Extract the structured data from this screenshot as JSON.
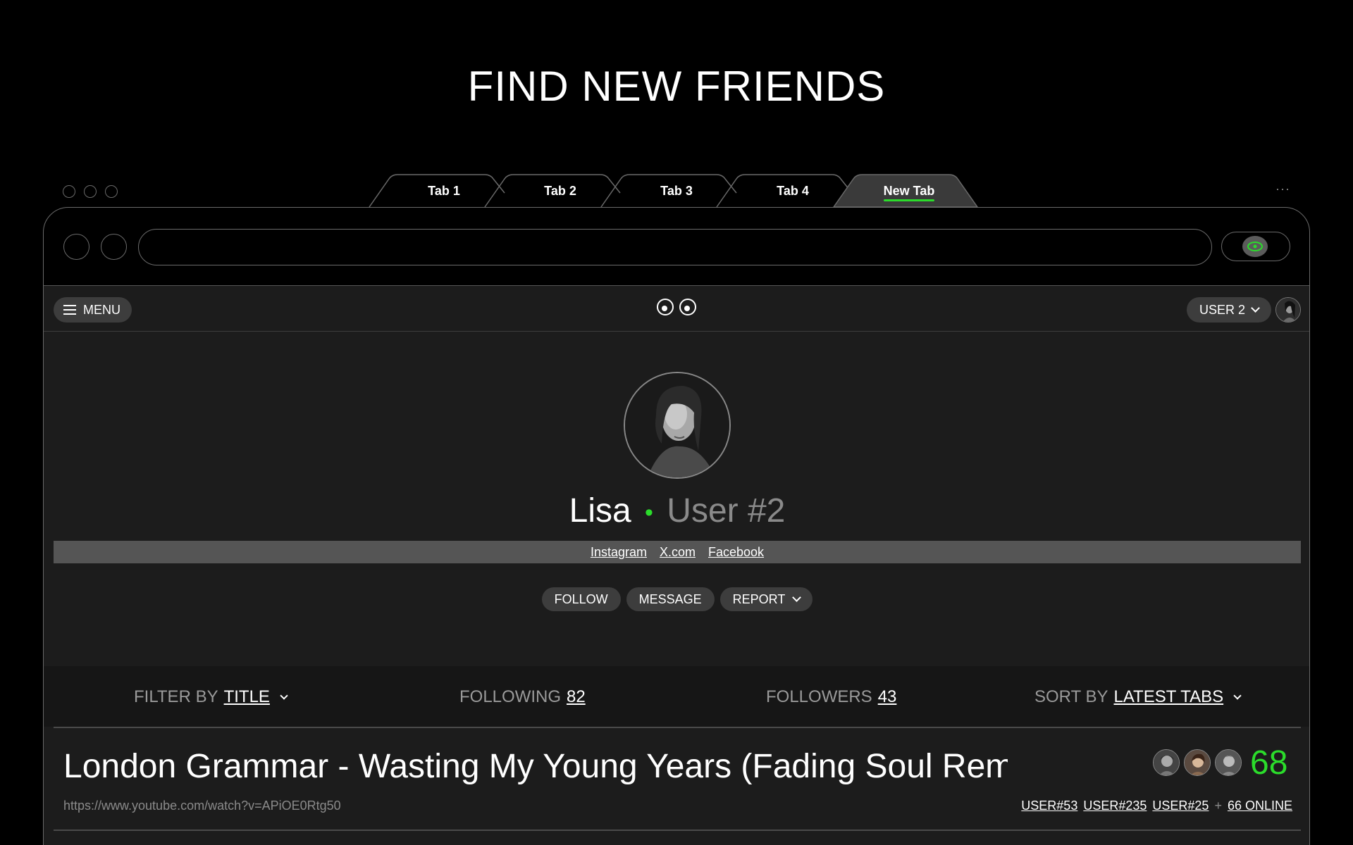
{
  "page": {
    "title": "FIND NEW FRIENDS"
  },
  "window": {
    "more_label": "···"
  },
  "tabs": [
    {
      "label": "Tab 1",
      "active": false
    },
    {
      "label": "Tab 2",
      "active": false
    },
    {
      "label": "Tab 3",
      "active": false
    },
    {
      "label": "Tab 4",
      "active": false
    },
    {
      "label": "New Tab",
      "active": true
    }
  ],
  "address_bar": {
    "value": ""
  },
  "app_bar": {
    "menu_label": "MENU",
    "user_label": "USER 2"
  },
  "profile": {
    "name": "Lisa",
    "separator": "•",
    "user_id": "User #2",
    "status_color": "#2bdc2b",
    "socials": [
      "Instagram",
      "X.com",
      "Facebook"
    ],
    "actions": {
      "follow": "FOLLOW",
      "message": "MESSAGE",
      "report": "REPORT"
    }
  },
  "stats": {
    "filter_prefix": "FILTER BY",
    "filter_value": "TITLE",
    "following_label": "FOLLOWING",
    "following_value": "82",
    "followers_label": "FOLLOWERS",
    "followers_value": "43",
    "sort_prefix": "SORT BY",
    "sort_value": "LATEST TABS"
  },
  "list": [
    {
      "title": "London Grammar - Wasting My Young Years (Fading Soul Remix)",
      "url": "https://www.youtube.com/watch?v=APiOE0Rtg50",
      "count": "68",
      "users": [
        "USER#53",
        "USER#235",
        "USER#25"
      ],
      "plus": "+",
      "online": "66 ONLINE"
    }
  ],
  "colors": {
    "accent": "#2bdc2b",
    "panel": "#1c1c1c",
    "pill": "#3d3d3d"
  }
}
